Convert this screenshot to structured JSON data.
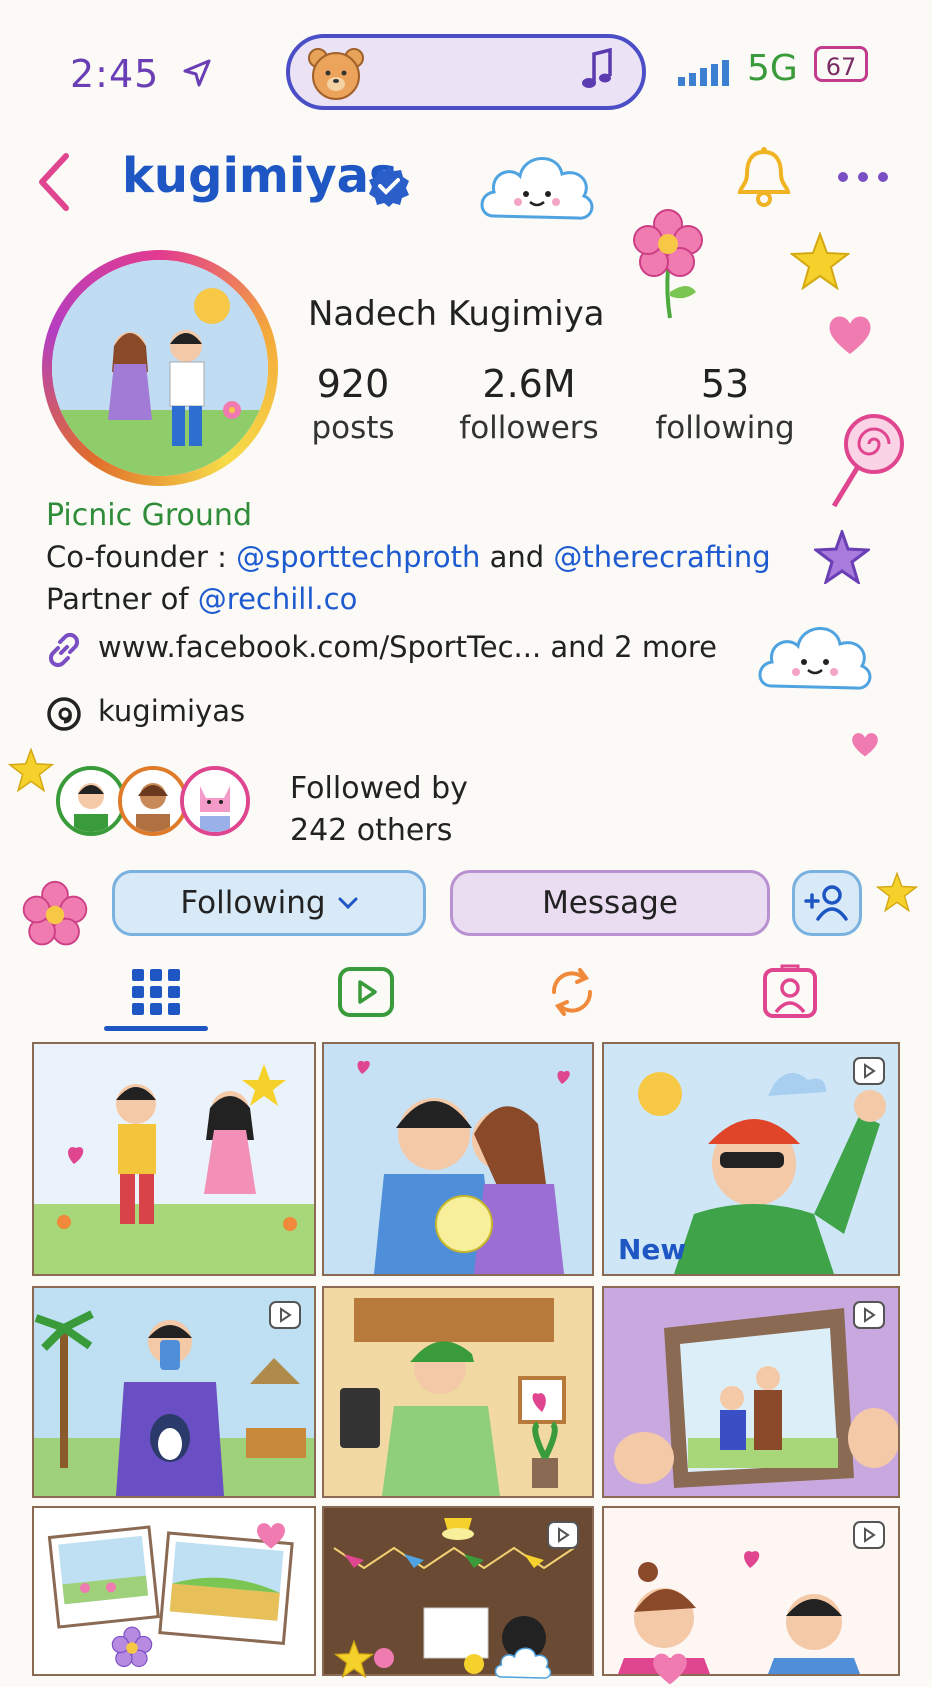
{
  "status_bar": {
    "time": "2:45",
    "network": "5G",
    "battery": "67"
  },
  "header": {
    "username": "kugimiyas"
  },
  "profile": {
    "full_name": "Nadech Kugimiya",
    "stats": [
      {
        "value": "920",
        "label": "posts"
      },
      {
        "value": "2.6M",
        "label": "followers"
      },
      {
        "value": "53",
        "label": "following"
      }
    ],
    "bio": {
      "category": "Picnic Ground",
      "line1_prefix": "Co-founder : ",
      "line1_mention1": "@sporttechproth",
      "line1_mid": " and ",
      "line1_mention2": "@therecrafting",
      "line2_prefix": "Partner of ",
      "line2_mention": "@rechill.co",
      "link": "www.facebook.com/SportTec... and 2 more",
      "threads": "kugimiyas"
    },
    "followed_by": {
      "line1": "Followed by",
      "line2": "242 others"
    }
  },
  "actions": {
    "following_label": "Following",
    "message_label": "Message"
  },
  "grid": {
    "new_label": "New"
  },
  "colors": {
    "accent": "#1e57c4",
    "bio_category": "#2f8d3a"
  }
}
